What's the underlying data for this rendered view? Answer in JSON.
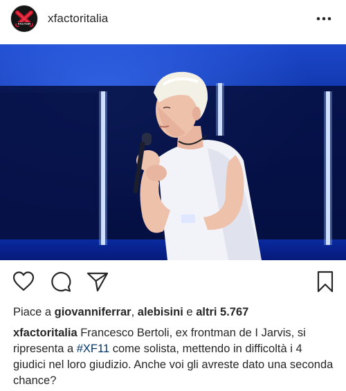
{
  "header": {
    "username": "xfactoritalia",
    "avatar_icon": "x-factor-logo",
    "more_icon": "more-horizontal-icon"
  },
  "photo": {
    "alt": "Francesco Bertoli on stage"
  },
  "actions": {
    "like_icon": "heart-icon",
    "comment_icon": "comment-icon",
    "share_icon": "share-icon",
    "save_icon": "bookmark-icon"
  },
  "likes": {
    "prefix": "Piace a",
    "user1": "giovanniferrar",
    "separator": ",",
    "user2": "alebisini",
    "conjunction": "e",
    "others": "altri 5.767"
  },
  "caption": {
    "username": "xfactoritalia",
    "text_before": "Francesco Bertoli, ex frontman de I Jarvis, si ripresenta a",
    "hashtag": "#XF11",
    "text_after": "come solista, mettendo in difficoltà i 4 giudici nel loro giudizio. Anche voi gli avreste dato una seconda chance?"
  },
  "colors": {
    "text": "#262626",
    "hashtag": "#003569",
    "stage_blue": "#0b2a86"
  }
}
